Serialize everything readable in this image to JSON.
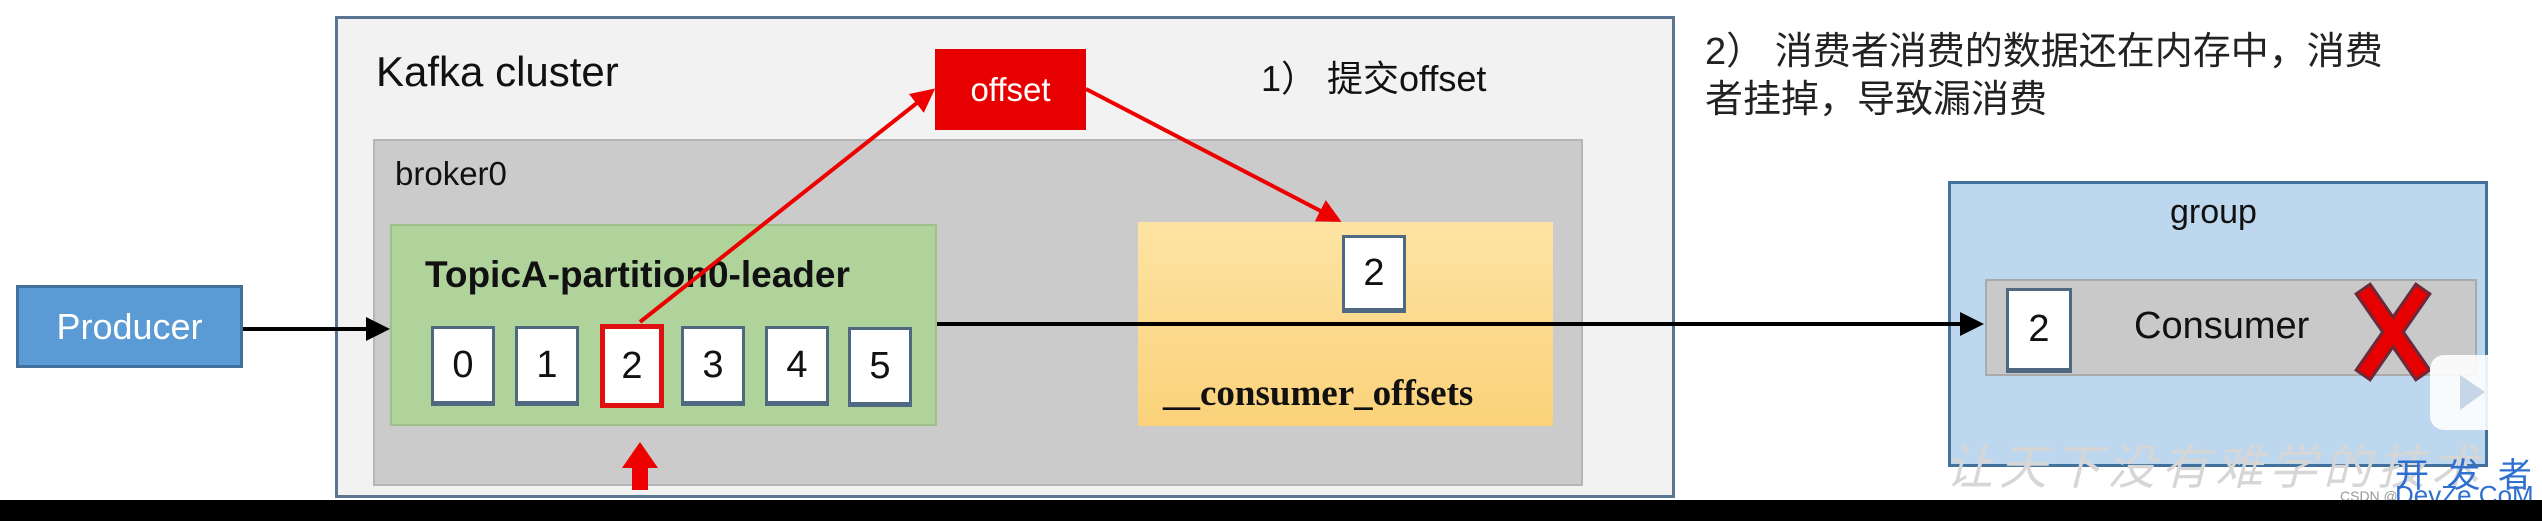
{
  "cluster": {
    "title": "Kafka cluster",
    "step1": "1） 提交offset",
    "offset_label": "offset"
  },
  "broker": {
    "title": "broker0"
  },
  "partition": {
    "title": "TopicA-partition0-leader",
    "offsets": [
      "0",
      "1",
      "2",
      "3",
      "4",
      "5"
    ],
    "highlighted": "2"
  },
  "consumer_offsets": {
    "value": "2",
    "label": "__consumer_offsets"
  },
  "producer": {
    "label": "Producer"
  },
  "group": {
    "title": "group",
    "consumer_label": "Consumer",
    "consumer_offset": "2",
    "status_icon": "red-x-icon"
  },
  "note": {
    "line1": "2） 消费者消费的数据还在内存中，消费",
    "line2": "者挂掉，导致漏消费"
  },
  "watermarks": {
    "slogan": "让天下没有难学的技术",
    "site_cn": "开 发 者",
    "site_en": "DevZe.CoM",
    "csdn": "CSDN @"
  },
  "colors": {
    "producer": "#5b9bd5",
    "partition": "#b0d39b",
    "consumer_offsets": "#fbd27a",
    "group": "#bdd7ee",
    "highlight": "#e60000"
  }
}
